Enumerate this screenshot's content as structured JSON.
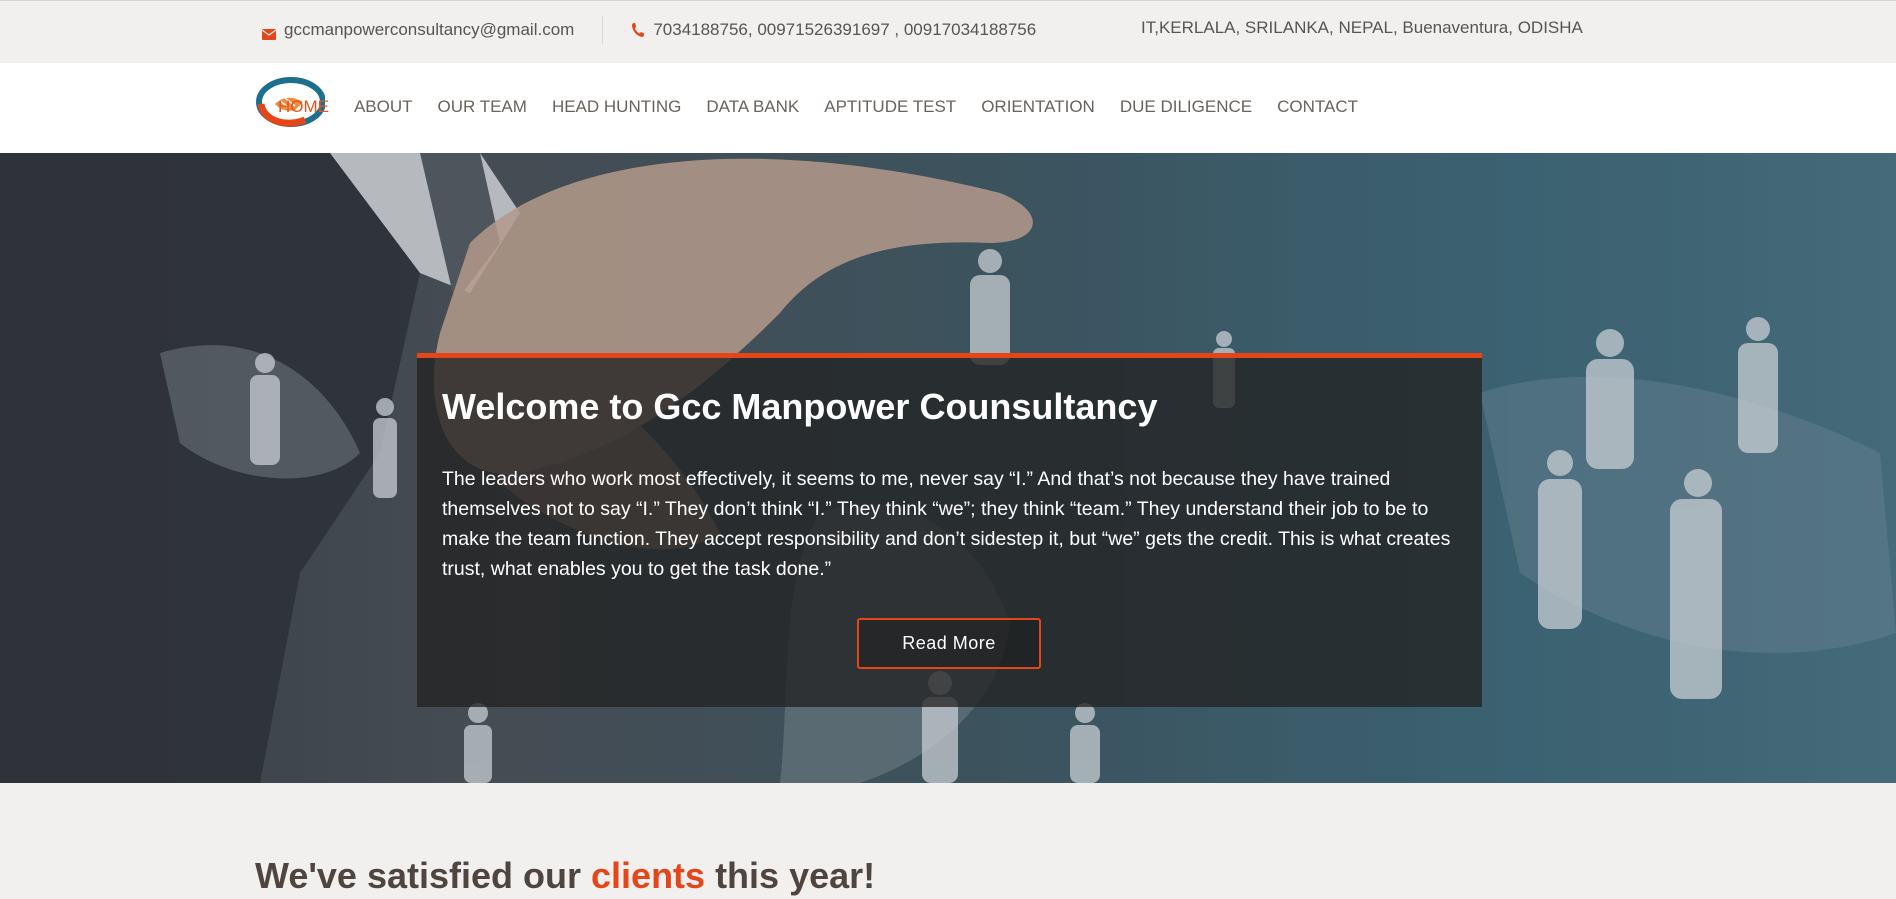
{
  "topbar": {
    "email": "gccmanpowerconsultancy@gmail.com",
    "email_icon": "mail-icon",
    "phone": "7034188756, 00971526391697 , 00917034188756",
    "phone_icon": "phone-icon",
    "locations": "IT,KERLALA, SRILANKA, NEPAL, Buenaventura, ODISHA"
  },
  "header": {
    "logo": "handshake-logo",
    "nav": [
      {
        "label": "HOME"
      },
      {
        "label": "ABOUT"
      },
      {
        "label": "OUR TEAM"
      },
      {
        "label": "HEAD HUNTING"
      },
      {
        "label": "DATA BANK"
      },
      {
        "label": "APTITUDE TEST"
      },
      {
        "label": "ORIENTATION"
      },
      {
        "label": "DUE DILIGENCE"
      },
      {
        "label": "CONTACT"
      }
    ]
  },
  "hero": {
    "title": "Welcome to Gcc Manpower Counsultancy",
    "text": "The leaders who work most effectively, it seems to me, never say “I.” And that’s not because they have trained themselves not to say “I.” They don’t think “I.” They think “we”; they think “team.” They understand their job to be to make the team function. They accept responsibility and don’t sidestep it, but “we” gets the credit. This is what creates trust, what enables you to get the task done.”",
    "button_label": "Read More"
  },
  "stats": {
    "heading_before": "We've satisfied our ",
    "heading_accent": "clients",
    "heading_after": " this year!"
  },
  "colors": {
    "accent": "#e4461a",
    "nav_text": "#6a625d",
    "topbar_bg": "#f2f0ee"
  }
}
